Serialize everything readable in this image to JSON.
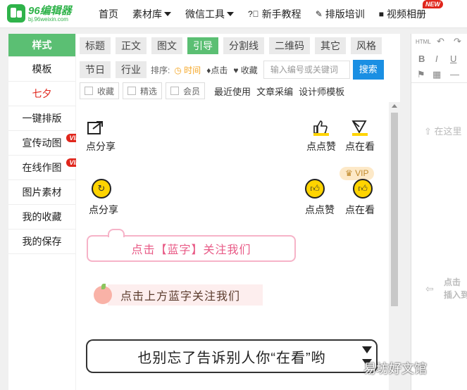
{
  "logo": {
    "title": "96编辑器",
    "subtitle": "bj.96weixin.com"
  },
  "nav": {
    "items": [
      "首页",
      "素材库",
      "微信工具",
      "新手教程",
      "排版培训",
      "视频相册"
    ],
    "new_badge": "NEW"
  },
  "leftnav": {
    "items": [
      {
        "label": "样式"
      },
      {
        "label": "模板"
      },
      {
        "label": "七夕"
      },
      {
        "label": "一键排版"
      },
      {
        "label": "宣传动图",
        "badge": "VIP"
      },
      {
        "label": "在线作图",
        "badge": "VIP"
      },
      {
        "label": "图片素材"
      },
      {
        "label": "我的收藏"
      },
      {
        "label": "我的保存"
      }
    ]
  },
  "tabs": [
    "标题",
    "正文",
    "图文",
    "引导",
    "分割线",
    "二维码",
    "其它",
    "风格"
  ],
  "active_tab": "引导",
  "row2": {
    "tabs": [
      "节日",
      "行业"
    ],
    "sort_label": "排序:",
    "sort_options": [
      "时间",
      "点击",
      "收藏"
    ],
    "search_placeholder": "输入编号或关键词",
    "search_button": "搜索"
  },
  "row3": {
    "filters": [
      "收藏",
      "精选",
      "会员"
    ],
    "links": [
      "最近使用",
      "文章采编",
      "设计师模板"
    ]
  },
  "templates": {
    "share1": "点分享",
    "like1": "点点赞",
    "view1": "点在看",
    "share2": "点分享",
    "like2": "点点赞",
    "view2": "点在看",
    "vip": "VIP",
    "banner1": "点击【蓝字】关注我们",
    "banner2": "点击上方蓝字关注我们",
    "banner3": "也别忘了告诉别人你“在看”哟"
  },
  "editor": {
    "html_label": "HTML",
    "hint_top": "在这里",
    "hint_bottom_1": "点击",
    "hint_bottom_2": "插入到"
  },
  "watermark": "易坊好文馆",
  "colors": {
    "accent": "#5bbf73",
    "red": "#e0261c",
    "blue": "#1a8fe3",
    "yellow": "#ffd400",
    "pink": "#e85a86"
  }
}
